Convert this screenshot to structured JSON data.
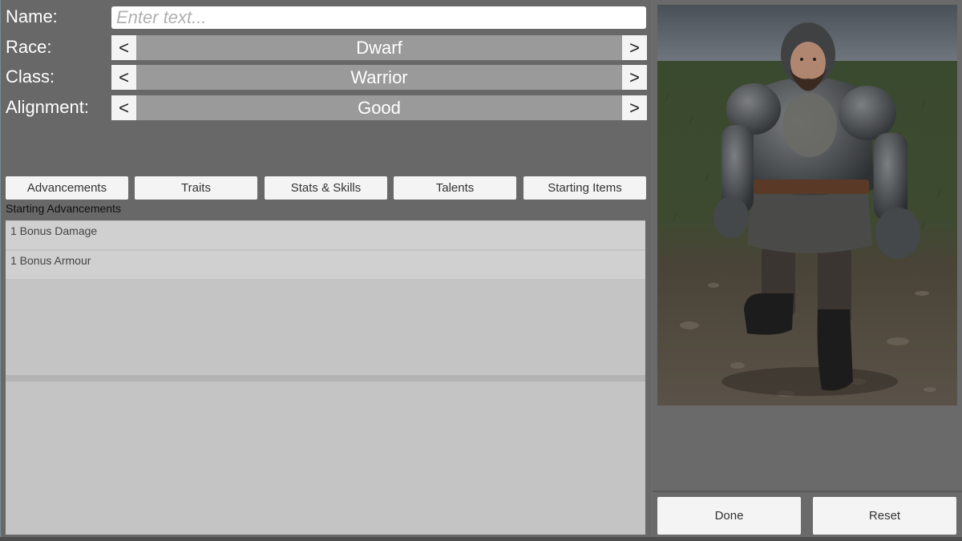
{
  "form": {
    "name_label": "Name:",
    "name_placeholder": "Enter text...",
    "name_value": "",
    "race_label": "Race:",
    "race_value": "Dwarf",
    "class_label": "Class:",
    "class_value": "Warrior",
    "alignment_label": "Alignment:",
    "alignment_value": "Good",
    "prev_glyph": "<",
    "next_glyph": ">"
  },
  "tabs": [
    {
      "label": "Advancements"
    },
    {
      "label": "Traits"
    },
    {
      "label": "Stats & Skills"
    },
    {
      "label": "Talents"
    },
    {
      "label": "Starting Items"
    }
  ],
  "section": {
    "title": "Starting Advancements",
    "items": [
      {
        "label": "1 Bonus Damage"
      },
      {
        "label": "1 Bonus Armour"
      }
    ]
  },
  "actions": {
    "done_label": "Done",
    "reset_label": "Reset"
  },
  "preview": {
    "subject": "armored dwarf warrior character model"
  }
}
